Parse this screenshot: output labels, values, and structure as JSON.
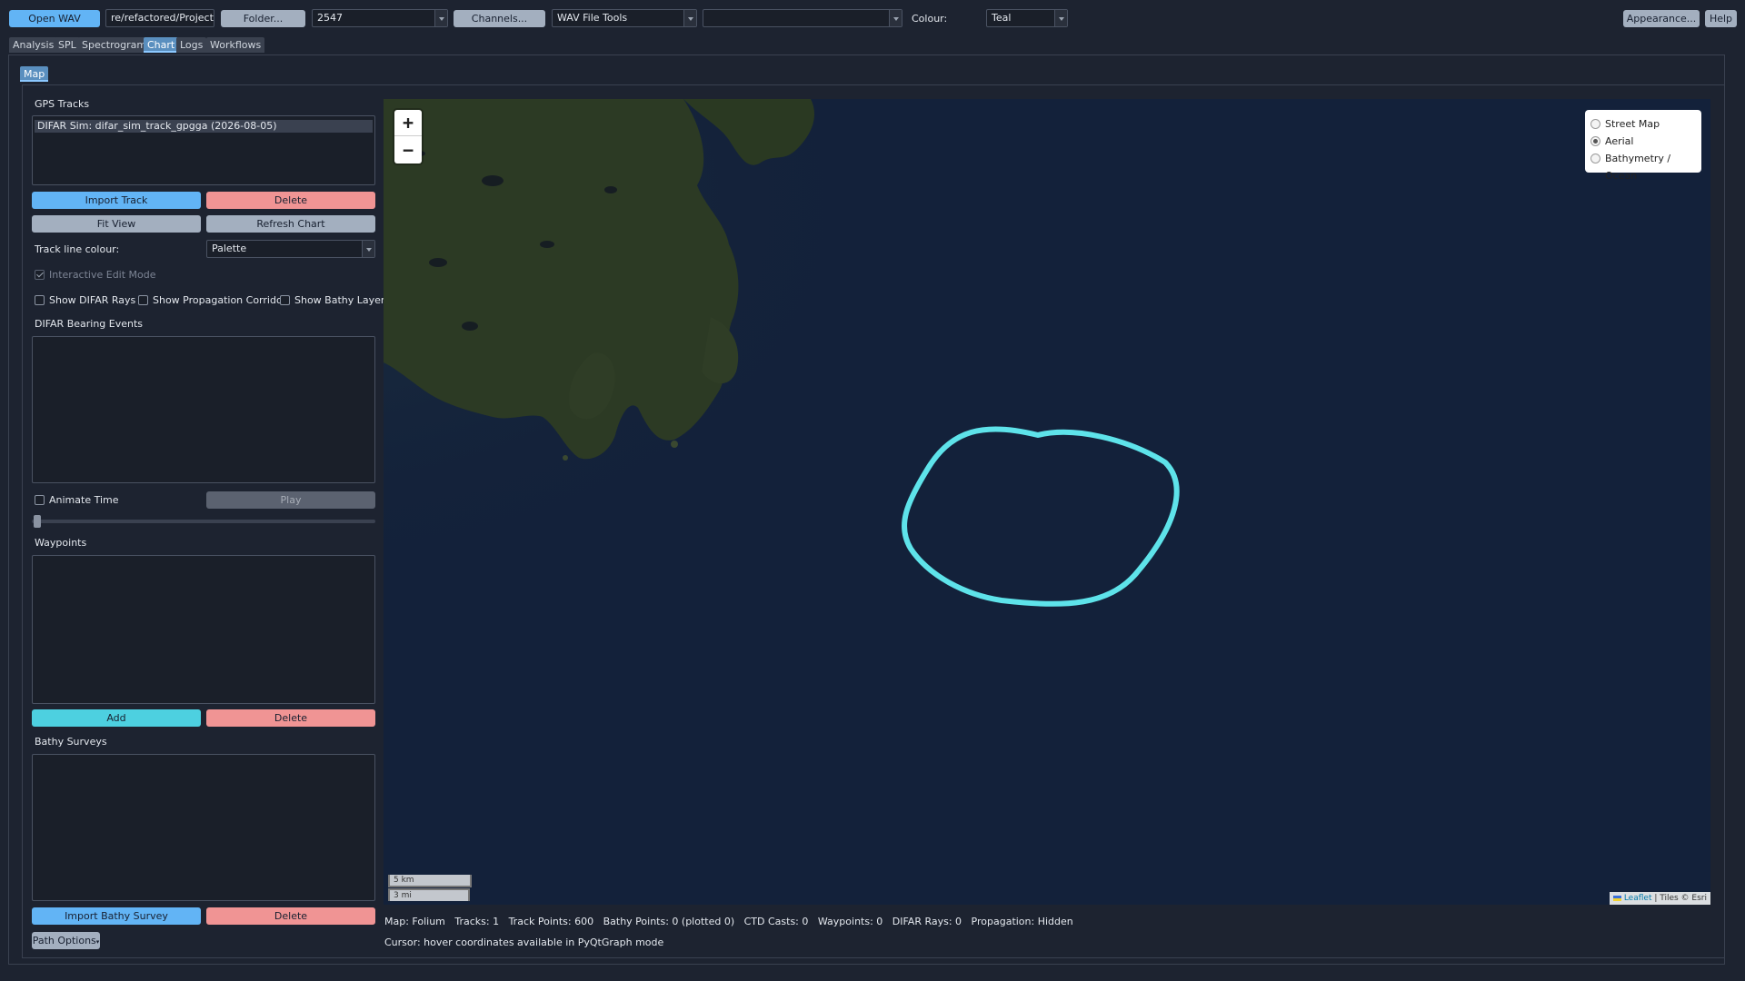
{
  "toolbar": {
    "open_wav": "Open WAV",
    "path_value": "re/refactored/Projects",
    "folder": "Folder...",
    "number_select": "2547",
    "channels": "Channels...",
    "tools_select": "WAV File Tools",
    "blank_select": "",
    "colour_label": "Colour:",
    "colour_select": "Teal",
    "appearance": "Appearance...",
    "help": "Help"
  },
  "tabs": [
    "Analysis",
    "SPL",
    "Spectrogram",
    "Chart",
    "Logs",
    "Workflows"
  ],
  "active_tab": "Chart",
  "subtab": "Map",
  "panel": {
    "gps_tracks_label": "GPS Tracks",
    "tracks": [
      "DIFAR Sim: difar_sim_track_gpgga (2026-08-05)"
    ],
    "import_track": "Import Track",
    "delete_track": "Delete",
    "fit_view": "Fit View",
    "refresh_chart": "Refresh Chart",
    "track_line_colour_label": "Track line colour:",
    "track_line_colour_value": "Palette",
    "interactive_edit_mode": "Interactive Edit Mode",
    "show_difar_rays": "Show DIFAR Rays",
    "show_propagation_corridor": "Show Propagation Corridor",
    "show_bathy_layer": "Show Bathy Layer",
    "difar_events_label": "DIFAR Bearing Events",
    "animate_time": "Animate Time",
    "play": "Play",
    "waypoints_label": "Waypoints",
    "add_waypoint": "Add",
    "delete_waypoint": "Delete",
    "bathy_surveys_label": "Bathy Surveys",
    "import_bathy": "Import Bathy Survey",
    "delete_bathy": "Delete",
    "path_options": "Path Options"
  },
  "map": {
    "zoom_in": "+",
    "zoom_out": "−",
    "layers": [
      "Street Map",
      "Aerial",
      "Bathymetry / Ocean"
    ],
    "selected_layer": "Aerial",
    "scale_km": "5 km",
    "scale_mi": "3 mi",
    "attribution_leaflet": "Leaflet",
    "attribution_rest": "| Tiles © Esri",
    "track_color": "#5ee3ea",
    "water_color": "#13213a",
    "land_color": "#2c3a24"
  },
  "status": {
    "line1": "Map: Folium   Tracks: 1   Track Points: 600   Bathy Points: 0 (plotted 0)   CTD Casts: 0   Waypoints: 0   DIFAR Rays: 0   Propagation: Hidden",
    "line2": "Cursor: hover coordinates available in PyQtGraph mode"
  }
}
